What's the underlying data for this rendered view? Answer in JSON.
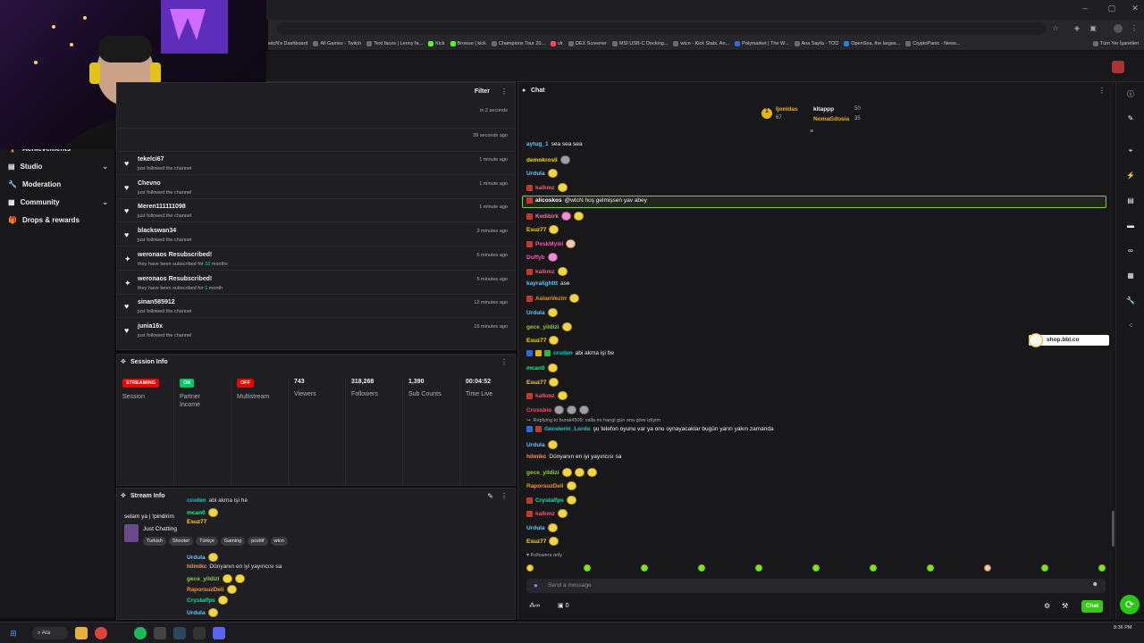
{
  "browser": {
    "bookmarks": [
      "wtcN's Dashboard",
      "All Games - Twitch",
      "Text faces | Lenny fa...",
      "Kick",
      "Browse | kick",
      "Champions Tour 20...",
      "vlr",
      "DEX Screener",
      "MSI USB-C Docking...",
      "wtcn - Kick Stats, An...",
      "Polymarket | The W...",
      "Ana Sayfa - TOD",
      "OpenSea, the larges...",
      "CryptoPanic - News...",
      "Tüm Yer İşaretleri"
    ]
  },
  "sidebar": {
    "items": [
      {
        "label": "Achievements",
        "icon": "trophy-icon",
        "chevron": false
      },
      {
        "label": "Studio",
        "icon": "studio-icon",
        "chevron": true
      },
      {
        "label": "Moderation",
        "icon": "wrench-icon",
        "chevron": false
      },
      {
        "label": "Community",
        "icon": "community-icon",
        "chevron": true
      },
      {
        "label": "Drops & rewards",
        "icon": "gift-icon",
        "chevron": false
      }
    ]
  },
  "activity": {
    "filter_label": "Filter",
    "top_times": [
      "in 2 seconds",
      "39 seconds ago"
    ],
    "rows": [
      {
        "name": "tekelci67",
        "sub": "just followed the channel",
        "time": "1 minute ago",
        "icon": "heart"
      },
      {
        "name": "Chevno",
        "sub": "just followed the channel",
        "time": "1 minute ago",
        "icon": "heart"
      },
      {
        "name": "Meren111111098",
        "sub": "just followed the channel",
        "time": "1 minute ago",
        "icon": "heart"
      },
      {
        "name": "blackswan34",
        "sub": "just followed the channel",
        "time": "2 minutes ago",
        "icon": "heart"
      },
      {
        "name": "weronaos Resubscribed!",
        "sub_pre": "they have been subscribed for ",
        "sub_num": "10",
        "sub_post": " months",
        "time": "5 minutes ago",
        "icon": "star"
      },
      {
        "name": "weronaos Resubscribed!",
        "sub_pre": "they have been subscribed for ",
        "sub_num": "1",
        "sub_post": " month",
        "time": "5 minutes ago",
        "icon": "star"
      },
      {
        "name": "sinan585912",
        "sub": "just followed the channel",
        "time": "12 minutes ago",
        "icon": "heart"
      },
      {
        "name": "junia16x",
        "sub": "just followed the channel",
        "time": "15 minutes ago",
        "icon": "heart"
      }
    ]
  },
  "session": {
    "title": "Session Info",
    "cols": [
      {
        "badge": "STREAMING",
        "badge_color": "#eb0400",
        "label": "Session"
      },
      {
        "badge": "ON",
        "badge_color": "#00c765",
        "label": "Partner Income"
      },
      {
        "badge": "OFF",
        "badge_color": "#eb0400",
        "label": "Multistream"
      },
      {
        "value": "743",
        "label": "Viewers"
      },
      {
        "value": "318,268",
        "label": "Followers"
      },
      {
        "value": "1,390",
        "label": "Sub Counts"
      },
      {
        "value": "00:04:52",
        "label": "Time Live"
      }
    ]
  },
  "streaminfo": {
    "title": "Stream Info",
    "stream_title": "selam ya | !pindirim",
    "category": "Just Chatting",
    "tags": [
      "Turkish",
      "Shooter",
      "Türkçe",
      "Gaming",
      "pozitif",
      "wtcn"
    ],
    "mini_chat": [
      {
        "user": "cruden",
        "color": "#00d0d0",
        "text": "abi akma işi he"
      },
      {
        "user": "mcan0",
        "color": "#00ff7f",
        "text": ""
      },
      {
        "user": "Esuz77",
        "color": "#ffd700",
        "text": ""
      },
      {
        "user": "Urdula",
        "color": "#5ec9ff",
        "text": ""
      },
      {
        "user": "hilmikc",
        "color": "#ff8c69",
        "text": "Dünyanın en iyi yayıncısı sa"
      },
      {
        "user": "gece_yildizi",
        "color": "#9acd32",
        "text": ""
      },
      {
        "user": "RaporsuzDeli",
        "color": "#ff9a00",
        "text": ""
      },
      {
        "user": "Crystalfps",
        "color": "#00e5a0",
        "text": ""
      },
      {
        "user": "Urdula",
        "color": "#5ec9ff",
        "text": ""
      }
    ]
  },
  "chat": {
    "title": "Chat",
    "leaderboard": [
      {
        "rank": "1",
        "name": "ljonidas",
        "count": "67"
      },
      {
        "name": "kitappp",
        "count": "50"
      },
      {
        "name": "NomaGdusia",
        "count": "35"
      }
    ],
    "messages": [
      {
        "user": "aytug_1",
        "color": "#5ec9ff",
        "text": "sea sea sea"
      },
      {
        "user": "demokrosli",
        "color": "#ffd700",
        "text": ""
      },
      {
        "user": "Urdula",
        "color": "#5ec9ff",
        "text": ""
      },
      {
        "user": "kalkmz",
        "color": "#ff4f6e",
        "text": ""
      },
      {
        "user": "alicoskos",
        "color": "#ffffff",
        "text": "@wtcN hoş gelmişsen yav abey",
        "highlight": true
      },
      {
        "user": "Kedibirk",
        "color": "#ff6b9d",
        "text": ""
      },
      {
        "user": "Esuz77",
        "color": "#ffd700",
        "text": ""
      },
      {
        "user": "PeskMyiki",
        "color": "#ff4fb0",
        "text": ""
      },
      {
        "user": "Duffyb",
        "color": "#ff4fb0",
        "text": ""
      },
      {
        "user": "kalkmz",
        "color": "#ff4f6e",
        "text": ""
      },
      {
        "user": "kayralighttt",
        "color": "#5ec9ff",
        "text": "ase"
      },
      {
        "user": "AslanVezirr",
        "color": "#ff9a00",
        "text": ""
      },
      {
        "user": "Urdula",
        "color": "#5ec9ff",
        "text": ""
      },
      {
        "user": "gece_yildizi",
        "color": "#9acd32",
        "text": ""
      },
      {
        "user": "Esuz77",
        "color": "#ffd700",
        "text": ""
      },
      {
        "user": "cruden",
        "color": "#00d0d0",
        "text": "abi akma işi he"
      },
      {
        "user": "mcan0",
        "color": "#00ff7f",
        "text": ""
      },
      {
        "user": "Esuz77",
        "color": "#ffd700",
        "text": ""
      },
      {
        "user": "kalkmz",
        "color": "#ff4f6e",
        "text": ""
      },
      {
        "user": "Crussbio",
        "color": "#ff4f6e",
        "text": ""
      },
      {
        "user": "Gecelerin_Lordu",
        "color": "#00d0d0",
        "text": "şu telefon oyunu var ya onu oynayacaklar bugün yarın yakın zamanda",
        "reply": "Replying to burak4509: valla mı hangi gün ona göre izliyim"
      },
      {
        "user": "Urdula",
        "color": "#5ec9ff",
        "text": ""
      },
      {
        "user": "hilmikc",
        "color": "#ff8c69",
        "text": "Dünyanın en iyi yayıncısı sa"
      },
      {
        "user": "gece_yildizi",
        "color": "#9acd32",
        "text": ""
      },
      {
        "user": "RaporsuzDeli",
        "color": "#ff9a00",
        "text": ""
      },
      {
        "user": "Crystalfps",
        "color": "#00e5a0",
        "text": ""
      },
      {
        "user": "kalkmz",
        "color": "#ff4f6e",
        "text": ""
      },
      {
        "user": "Urdula",
        "color": "#5ec9ff",
        "text": ""
      },
      {
        "user": "Esuz77",
        "color": "#ffd700",
        "text": ""
      }
    ],
    "followers_only": "Followers only",
    "input_placeholder": "Send a message",
    "points": "0",
    "send_label": "Chat",
    "ad_text": "shop.bbl.co"
  },
  "taskbar": {
    "search_label": "Ara",
    "clock": "8:36 PM"
  }
}
